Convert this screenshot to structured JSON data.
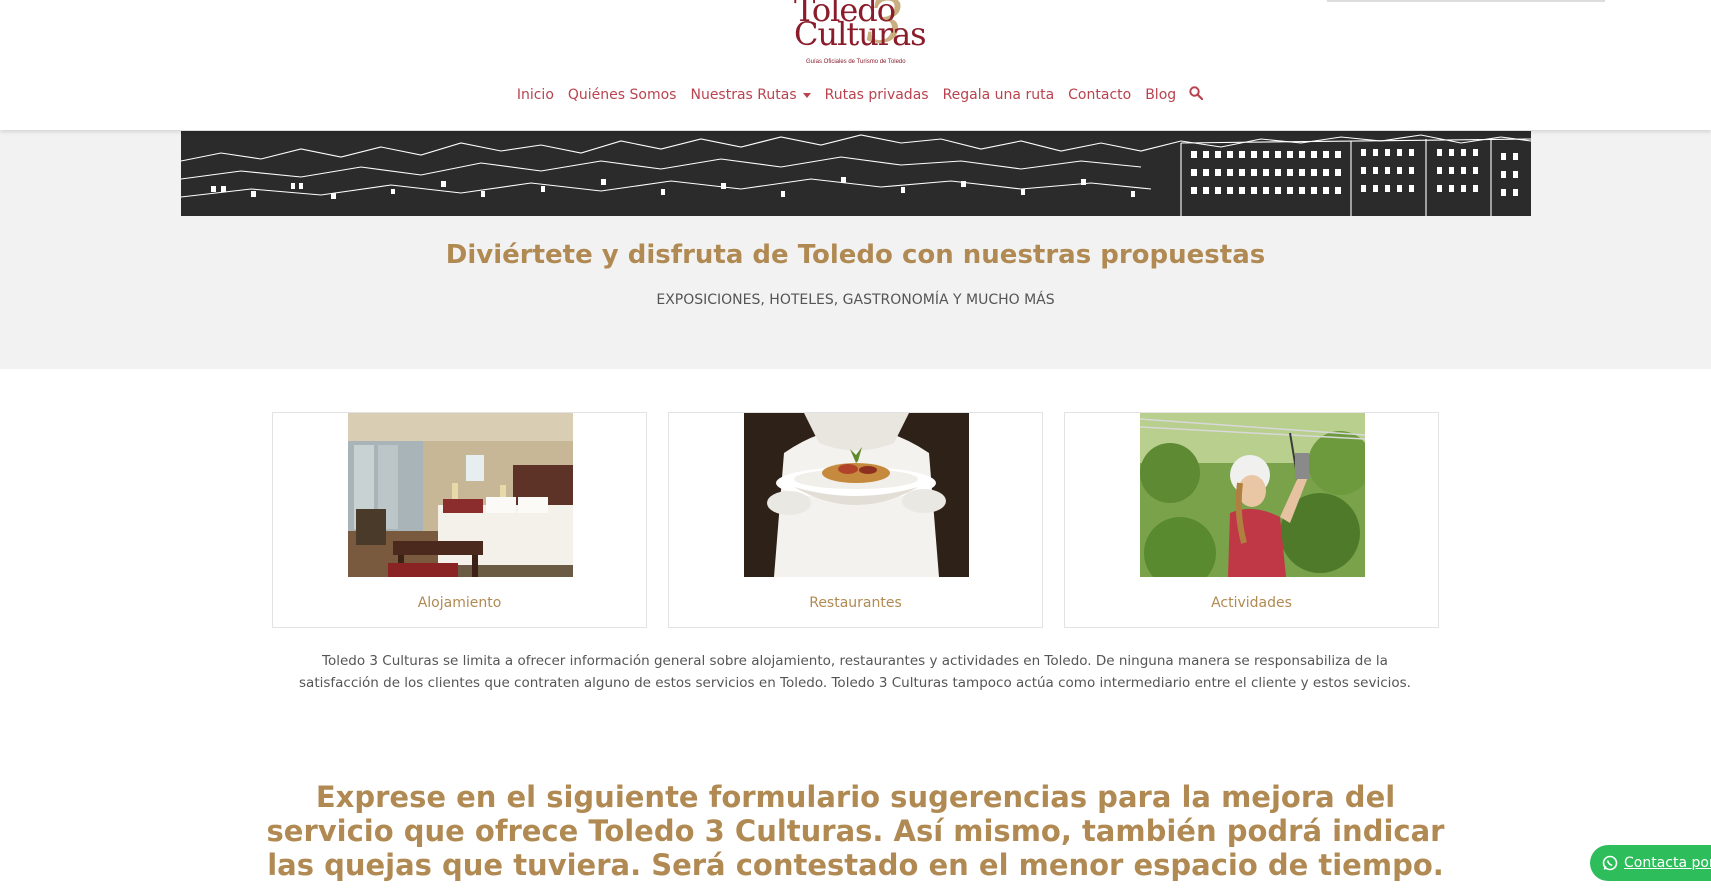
{
  "logo": {
    "line1": "Toledo",
    "line2": "Culturas",
    "numeral": "3",
    "tagline": "Guías Oficiales de Turismo de Toledo"
  },
  "nav": {
    "items": [
      {
        "label": "Inicio"
      },
      {
        "label": "Quiénes Somos"
      },
      {
        "label": "Nuestras Rutas"
      },
      {
        "label": "Rutas privadas"
      },
      {
        "label": "Regala una ruta"
      },
      {
        "label": "Contacto"
      },
      {
        "label": "Blog"
      }
    ],
    "search_icon": "search-icon"
  },
  "hero": {
    "title": "Diviértete y disfruta de Toledo con nuestras propuestas",
    "subtitle": "EXPOSICIONES, HOTELES, GASTRONOMÍA Y MUCHO MÁS"
  },
  "cards": [
    {
      "label": "Alojamiento"
    },
    {
      "label": "Restaurantes"
    },
    {
      "label": "Actividades"
    }
  ],
  "disclaimer": "Toledo 3 Culturas se limita a ofrecer información general sobre alojamiento, restaurantes y actividades en Toledo. De ninguna manera se responsabiliza de la satisfacción de los clientes que contraten alguno de estos servicios en Toledo. Toledo 3 Culturas tampoco actúa como intermediario entre el cliente y estos sevicios.",
  "form_intro": "Exprese en el siguiente formulario sugerencias para la mejora del servicio que ofrece Toledo 3 Culturas. Así mismo, también podrá indicar las quejas que tuviera. Será contestado en el menor espacio de tiempo.",
  "whatsapp": {
    "label": "Contacta por W"
  },
  "colors": {
    "nav_link": "#b8434f",
    "gold": "#b08a52",
    "brand": "#8a1c2b",
    "band_bg": "#f2f2f2",
    "whatsapp": "#2dbd5b"
  }
}
